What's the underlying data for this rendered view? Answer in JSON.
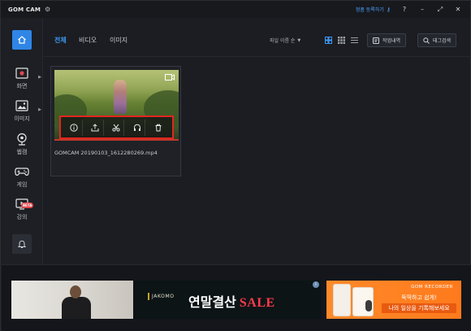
{
  "app": {
    "title": "GOM CAM",
    "register_link": "정품 등록하기",
    "help": "?",
    "minimize": "–",
    "restore": "⤢",
    "close": "✕"
  },
  "sidebar": {
    "items": [
      {
        "label": "화면",
        "icon": "screen-record-icon"
      },
      {
        "label": "이미지",
        "icon": "image-icon"
      },
      {
        "label": "웹캠",
        "icon": "webcam-icon"
      },
      {
        "label": "게임",
        "icon": "gamepad-icon"
      },
      {
        "label": "강의",
        "icon": "lecture-icon",
        "badge": "BETA"
      }
    ],
    "home_icon": "home-icon",
    "bell_icon": "bell-icon"
  },
  "main": {
    "tabs": [
      {
        "label": "전체",
        "active": true
      },
      {
        "label": "비디오",
        "active": false
      },
      {
        "label": "이미지",
        "active": false
      }
    ],
    "sort": {
      "value": "파일 이름 순"
    },
    "view_modes": [
      "large-grid-icon",
      "small-grid-icon",
      "list-icon"
    ],
    "history_button": "작업내역",
    "tag_search_button": "태그검색",
    "files": [
      {
        "name": "GOMCAM 20190103_1612280269.mp4",
        "type_icon": "video-camera-icon"
      }
    ],
    "card_actions": [
      "info-icon",
      "share-icon",
      "cut-icon",
      "audio-icon",
      "delete-icon"
    ]
  },
  "ads": {
    "left": {
      "brand": "JAKOMO",
      "headline": "연말결산",
      "sale": "SALE"
    },
    "right": {
      "brand": "GOM RECORDER",
      "line1": "뚝딱하고 쉽게!",
      "line2": "나의 일상을 기록해보세요"
    }
  },
  "colors": {
    "accent": "#2f86e6",
    "highlight_box": "#e3261f",
    "beta_badge": "#e0484d",
    "ad_orange": "#ff8a2a"
  }
}
